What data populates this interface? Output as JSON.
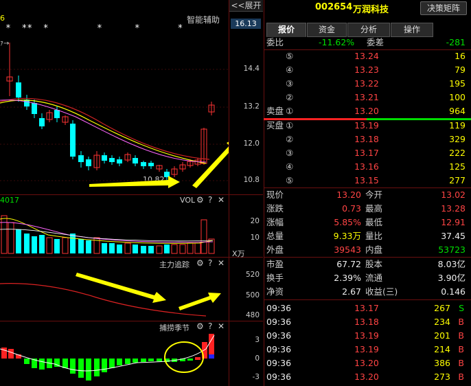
{
  "header": {
    "expand_label": "<<展开",
    "stock_code": "002654",
    "stock_name": "万润科技",
    "matrix_button": "决策矩阵"
  },
  "kline": {
    "title": "智能辅助",
    "partial_left": "6",
    "stars": "*  **  *         *      *       *",
    "current_price_tag": "16.13",
    "y_ticks": [
      "14.4",
      "13.2",
      "12.0",
      "10.8"
    ],
    "low_label": "10.82"
  },
  "vol_panel": {
    "partial_left": "4017",
    "title": "VOL",
    "y_ticks": [
      "20",
      "10"
    ],
    "unit": "X万"
  },
  "main_force": {
    "title": "主力追踪",
    "y_ticks": [
      "520",
      "500",
      "480"
    ]
  },
  "capture": {
    "title": "捕捞季节",
    "y_ticks": [
      "3",
      "0",
      "-3"
    ]
  },
  "tabs": [
    "报价",
    "资金",
    "分析",
    "操作"
  ],
  "commission": {
    "ratio_label": "委比",
    "ratio_value": "-11.62%",
    "diff_label": "委差",
    "diff_value": "-281"
  },
  "sell_orders": [
    {
      "label": "",
      "level": "⑤",
      "price": "13.24",
      "vol": "16"
    },
    {
      "label": "",
      "level": "④",
      "price": "13.23",
      "vol": "79"
    },
    {
      "label": "",
      "level": "③",
      "price": "13.22",
      "vol": "195"
    },
    {
      "label": "",
      "level": "②",
      "price": "13.21",
      "vol": "100"
    },
    {
      "label": "卖盘",
      "level": "①",
      "price": "13.20",
      "vol": "964"
    }
  ],
  "buy_orders": [
    {
      "label": "买盘",
      "level": "①",
      "price": "13.19",
      "vol": "119"
    },
    {
      "label": "",
      "level": "②",
      "price": "13.18",
      "vol": "329"
    },
    {
      "label": "",
      "level": "③",
      "price": "13.17",
      "vol": "222"
    },
    {
      "label": "",
      "level": "④",
      "price": "13.16",
      "vol": "125"
    },
    {
      "label": "",
      "level": "⑤",
      "price": "13.15",
      "vol": "277"
    }
  ],
  "quote": [
    {
      "l1": "现价",
      "v1": "13.20",
      "c1": "red",
      "l2": "今开",
      "v2": "13.02",
      "c2": "red"
    },
    {
      "l1": "涨跌",
      "v1": "0.73",
      "c1": "red",
      "l2": "最高",
      "v2": "13.28",
      "c2": "red"
    },
    {
      "l1": "涨幅",
      "v1": "5.85%",
      "c1": "red",
      "l2": "最低",
      "v2": "12.91",
      "c2": "red"
    },
    {
      "l1": "总量",
      "v1": "9.33万",
      "c1": "yellow",
      "l2": "量比",
      "v2": "37.45",
      "c2": "white"
    },
    {
      "l1": "外盘",
      "v1": "39543",
      "c1": "red",
      "l2": "内盘",
      "v2": "53723",
      "c2": "green"
    }
  ],
  "fundamentals": [
    {
      "l1": "市盈",
      "v1": "67.72",
      "l2": "股本",
      "v2": "8.03亿"
    },
    {
      "l1": "换手",
      "v1": "2.39%",
      "l2": "流通",
      "v2": "3.90亿"
    },
    {
      "l1": "净资",
      "v1": "2.67",
      "l2": "收益(三)",
      "v2": "0.146"
    }
  ],
  "ticks": [
    {
      "time": "09:36",
      "price": "13.17",
      "vol": "267",
      "side": "S",
      "side_color": "green"
    },
    {
      "time": "09:36",
      "price": "13.18",
      "vol": "234",
      "side": "B",
      "side_color": "red"
    },
    {
      "time": "09:36",
      "price": "13.19",
      "vol": "201",
      "side": "B",
      "side_color": "red"
    },
    {
      "time": "09:36",
      "price": "13.19",
      "vol": "214",
      "side": "B",
      "side_color": "red"
    },
    {
      "time": "09:36",
      "price": "13.20",
      "vol": "386",
      "side": "B",
      "side_color": "red"
    },
    {
      "time": "09:36",
      "price": "13.20",
      "vol": "273",
      "side": "B",
      "side_color": "red"
    }
  ]
}
